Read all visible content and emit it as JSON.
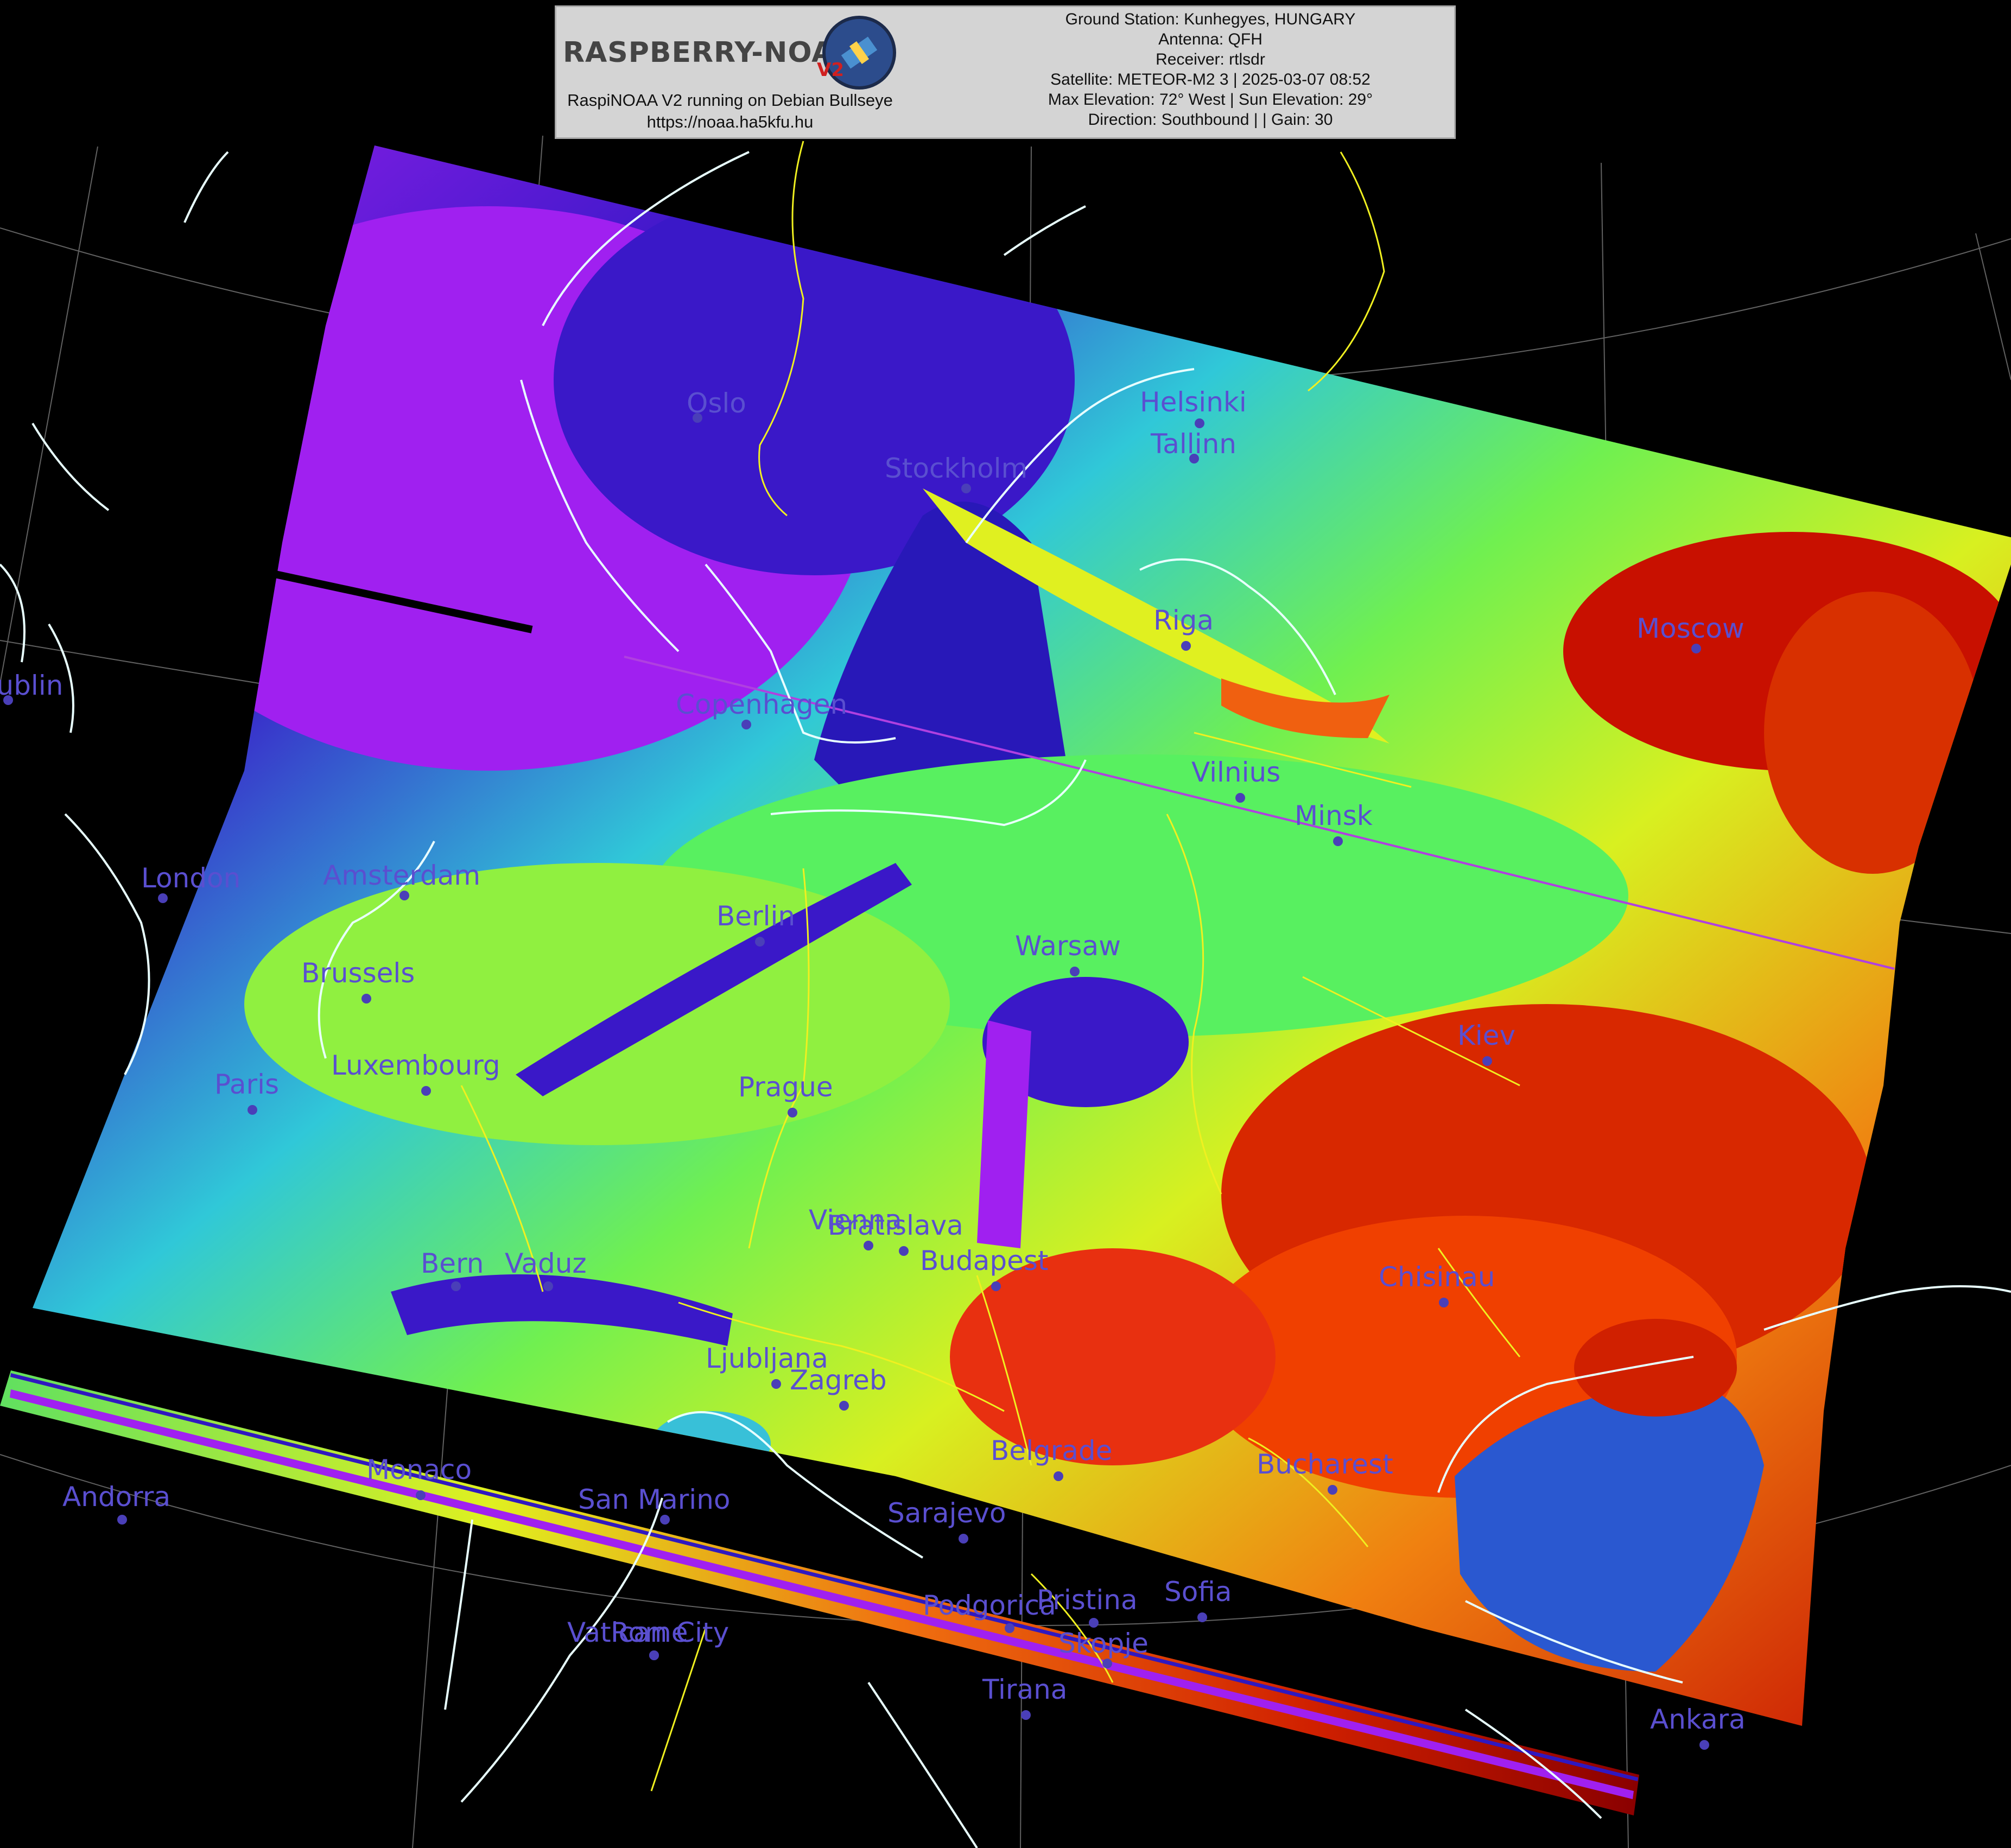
{
  "header": {
    "logo_text": "RASPBERRY-NOAA",
    "logo_version": "V2",
    "running_text": "RaspiNOAA V2 running on Debian Bullseye",
    "url_text": "https://noaa.ha5kfu.hu",
    "info_lines": [
      "Ground Station: Kunhegyes, HUNGARY",
      "Antenna: QFH",
      "Receiver: rtlsdr",
      "Satellite: METEOR-M2 3 | 2025-03-07 08:52",
      "Max Elevation: 72° West | Sun Elevation: 29°",
      "Direction: Southbound | | Gain: 30"
    ]
  },
  "palette": {
    "background": "#000000",
    "cloud_purple": "#a020f0",
    "cold_blue": "#3010c0",
    "cyan": "#20d0d0",
    "green": "#60f060",
    "yellow": "#f0f020",
    "red": "#d01000",
    "dark_red": "#8a0000",
    "sea_blue": "#1840c0",
    "label_color": "#5a4fd0",
    "border_yellow": "#f0f020",
    "coast_white": "#e8ffff",
    "graticule": "#9a9a9a"
  },
  "cities": [
    {
      "name": "Oslo"
    },
    {
      "name": "Helsinki"
    },
    {
      "name": "Tallinn"
    },
    {
      "name": "Stockholm"
    },
    {
      "name": "Riga"
    },
    {
      "name": "Moscow"
    },
    {
      "name": "Dublin"
    },
    {
      "name": "Copenhagen"
    },
    {
      "name": "Vilnius"
    },
    {
      "name": "Minsk"
    },
    {
      "name": "London"
    },
    {
      "name": "Amsterdam"
    },
    {
      "name": "Berlin"
    },
    {
      "name": "Warsaw"
    },
    {
      "name": "Brussels"
    },
    {
      "name": "Kiev"
    },
    {
      "name": "Paris"
    },
    {
      "name": "Luxembourg"
    },
    {
      "name": "Prague"
    },
    {
      "name": "Vienna"
    },
    {
      "name": "Bratislava"
    },
    {
      "name": "Budapest"
    },
    {
      "name": "Bern"
    },
    {
      "name": "Vaduz"
    },
    {
      "name": "Chisinau"
    },
    {
      "name": "Ljubljana"
    },
    {
      "name": "Zagreb"
    },
    {
      "name": "Belgrade"
    },
    {
      "name": "Bucharest"
    },
    {
      "name": "Monaco"
    },
    {
      "name": "Andorra"
    },
    {
      "name": "San Marino"
    },
    {
      "name": "Sarajevo"
    },
    {
      "name": "Pristina"
    },
    {
      "name": "Sofia"
    },
    {
      "name": "Podgorica"
    },
    {
      "name": "Vatican City"
    },
    {
      "name": "Rome"
    },
    {
      "name": "Skopje"
    },
    {
      "name": "Tirana"
    },
    {
      "name": "Ankara"
    }
  ]
}
